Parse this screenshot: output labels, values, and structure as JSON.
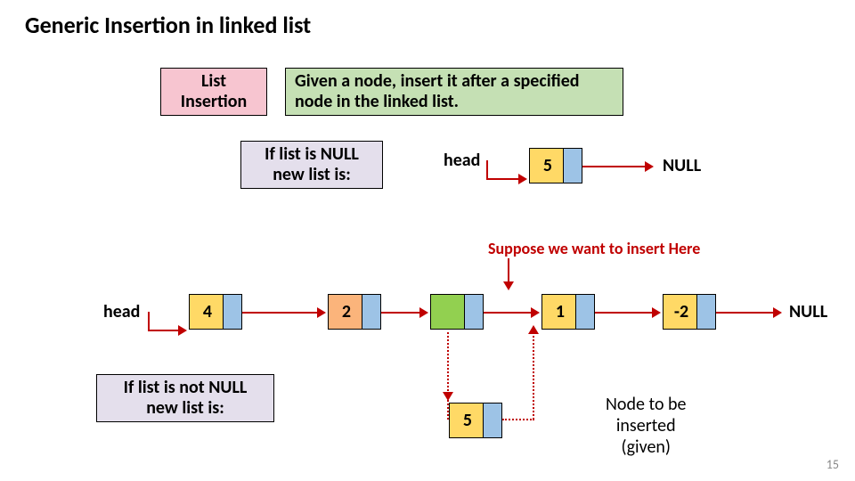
{
  "title": "Generic Insertion in linked list",
  "box_list_insertion": "List\nInsertion",
  "box_given": "Given a node, insert it after a specified node in the linked list.",
  "box_if_null": "If list is NULL\nnew list is:",
  "box_if_not_null": "If list is not NULL\nnew list is:",
  "label_head1": "head",
  "label_head2": "head",
  "label_null1": "NULL",
  "label_null2": "NULL",
  "label_suppose": "Suppose we want to insert Here",
  "label_node_to_insert": "Node to be\ninserted\n(given)",
  "nodes": {
    "n5a": "5",
    "n4": "4",
    "n2": "2",
    "n1": "1",
    "nm2": "-2",
    "n5b": "5"
  },
  "page": "15"
}
